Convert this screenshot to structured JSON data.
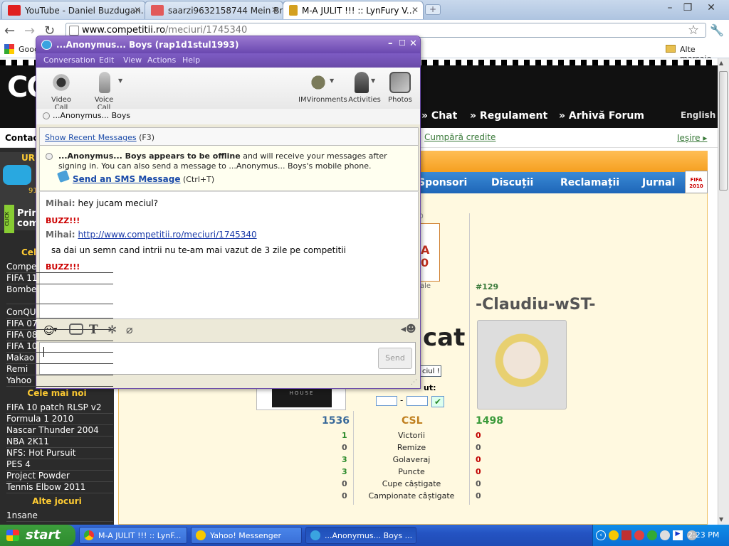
{
  "browser": {
    "tabs": [
      {
        "label": "YouTube - Daniel Buzdugan...",
        "icon": "youtube-icon",
        "icon_color": "#e02020"
      },
      {
        "label": "saarzi9632158744 Mein Br...",
        "icon": "x-icon",
        "icon_color": "#e25a5a"
      },
      {
        "label": "M-A JULIT !!! :: LynFury V...",
        "icon": "trophy-icon",
        "icon_color": "#d4a020"
      }
    ],
    "new_tab": "+",
    "url_domain": "www.competitii.ro",
    "url_path": "/meciuri/1745340",
    "bookmarks": [
      {
        "label": "Goog"
      }
    ],
    "other_bookmarks": "Alte marcaje"
  },
  "site": {
    "logo": "CO",
    "nav": [
      "Chat",
      "Regulament",
      "Arhivă Forum"
    ],
    "english": "English",
    "contact": "Contact",
    "buy_credits": "Cumpără credite",
    "logout": "Ieșire",
    "blue_nav": [
      "Sponsori",
      "Discuții",
      "Reclamații",
      "Jurnal"
    ],
    "fifa_badge": "FIFA 2010",
    "sidebar": {
      "top_label": "URM",
      "top_small": "91",
      "promo_label": "Prim com",
      "promo_click": "CLICK",
      "popular_heading": "Cele",
      "popular": [
        "Compe",
        "FIFA 11",
        "Bombe Interna",
        "ConQU",
        "FIFA 07",
        "FIFA 08",
        "FIFA 10",
        "Makao",
        "Remi",
        "Yahoo"
      ],
      "newest_heading": "Cele mai noi",
      "newest": [
        "FIFA 10 patch RLSP v2",
        "Formula 1 2010",
        "Nascar Thunder 2004",
        "NBA 2K11",
        "NFS: Hot Pursuit",
        "PES 4",
        "Project Powder",
        "Tennis Elbow 2011"
      ],
      "other_heading": "Alte jocuri",
      "other": [
        "1nsane"
      ]
    },
    "match": {
      "fifa_tile_text": "A 0",
      "ale": "ale",
      "zero": "0",
      "player_rank": "#129",
      "player_name": "-Claudiu-wST-",
      "cat": "cat",
      "ciul": "ciul !",
      "result_label": "ut:",
      "dash": "-",
      "house_label": "HOUSE",
      "score_left": "1536",
      "center_label": "CSL",
      "score_right": "1498",
      "stats": [
        {
          "left": "1",
          "label": "Victorii",
          "right": "0",
          "left_color": "#2a8a2a",
          "right_color": "#c00000"
        },
        {
          "left": "0",
          "label": "Remize",
          "right": "0",
          "left_color": "#555555",
          "right_color": "#555555"
        },
        {
          "left": "3",
          "label": "Golaveraj",
          "right": "0",
          "left_color": "#2a8a2a",
          "right_color": "#c00000"
        },
        {
          "left": "3",
          "label": "Puncte",
          "right": "0",
          "left_color": "#2a8a2a",
          "right_color": "#c00000"
        },
        {
          "left": "0",
          "label": "Cupe câștigate",
          "right": "0",
          "left_color": "#555555",
          "right_color": "#555555"
        },
        {
          "left": "0",
          "label": "Campionate câștigate",
          "right": "0",
          "left_color": "#555555",
          "right_color": "#555555"
        }
      ]
    }
  },
  "messenger": {
    "title": "...Anonymus... Boys (rap1d1stul1993)",
    "menu": [
      "Conversation",
      "Edit",
      "View",
      "Actions",
      "Help"
    ],
    "tools_left": [
      {
        "label": "Video Call",
        "icon": "webcam-icon"
      },
      {
        "label": "Voice Call",
        "icon": "microphone-icon"
      }
    ],
    "tools_right": [
      {
        "label": "IMVironments",
        "icon": "imvironments-icon"
      },
      {
        "label": "Activities",
        "icon": "activities-icon"
      },
      {
        "label": "Photos",
        "icon": "photos-icon"
      }
    ],
    "contact": "...Anonymus... Boys",
    "show_recent": "Show Recent Messages",
    "show_recent_shortcut": "(F3)",
    "offline_bold": "...Anonymus... Boys appears to be offline",
    "offline_rest": "and will receive your messages after signing in. You can also send a message to ...Anonymus... Boys's mobile phone.",
    "sms_link": "Send an SMS Message",
    "sms_shortcut": "(Ctrl+T)",
    "messages": [
      {
        "who": "Mihai:",
        "text": "hey jucam meciul?"
      },
      {
        "buzz": "BUZZ!!!"
      },
      {
        "who": "Mihai:",
        "link": "http://www.competitii.ro/meciuri/1745340"
      },
      {
        "text": "sa dai un semn cand intrii nu te-am mai vazut de 3 zile pe competitii"
      },
      {
        "buzz": "BUZZ!!!"
      }
    ],
    "send": "Send"
  },
  "taskbar": {
    "start": "start",
    "tasks": [
      {
        "label": "M-A JULIT !!! :: LynF...",
        "icon": "chrome-icon"
      },
      {
        "label": "Yahoo! Messenger",
        "icon": "yahoo-smiley-icon"
      },
      {
        "label": "...Anonymus... Boys ...",
        "icon": "messenger-icon"
      }
    ],
    "clock": "2:23 PM"
  }
}
